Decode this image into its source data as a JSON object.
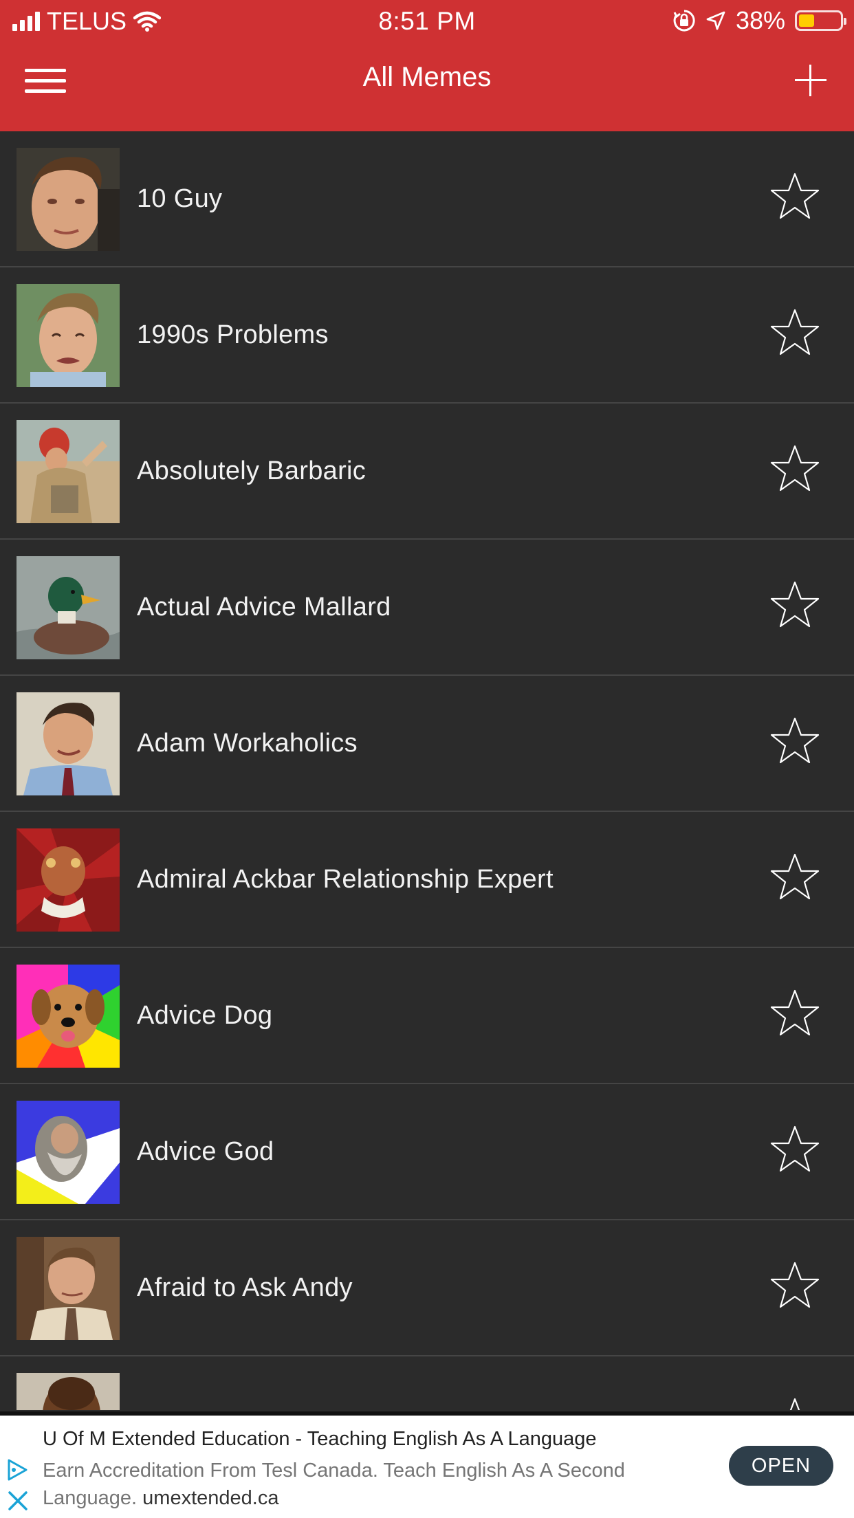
{
  "status_bar": {
    "carrier": "TELUS",
    "time": "8:51 PM",
    "battery_percent": "38%",
    "battery_level": 0.38,
    "icons": [
      "signal-bars-icon",
      "wifi-icon",
      "orientation-lock-icon",
      "location-arrow-icon",
      "battery-icon"
    ]
  },
  "nav": {
    "title": "All Memes",
    "menu_icon": "hamburger-menu-icon",
    "add_icon": "plus-icon"
  },
  "memes": [
    {
      "name": "10 Guy",
      "favorited": false
    },
    {
      "name": "1990s Problems",
      "favorited": false
    },
    {
      "name": "Absolutely Barbaric",
      "favorited": false
    },
    {
      "name": "Actual Advice Mallard",
      "favorited": false
    },
    {
      "name": "Adam Workaholics",
      "favorited": false
    },
    {
      "name": "Admiral Ackbar Relationship Expert",
      "favorited": false
    },
    {
      "name": "Advice Dog",
      "favorited": false
    },
    {
      "name": "Advice God",
      "favorited": false
    },
    {
      "name": "Afraid to Ask Andy",
      "favorited": false
    },
    {
      "name": "",
      "favorited": false
    }
  ],
  "ad": {
    "title": "U Of M Extended Education - Teaching English As A Language",
    "description": "Earn Accreditation From Tesl Canada. Teach English As A Second Language.",
    "domain": "umextended.ca",
    "cta": "OPEN"
  },
  "colors": {
    "header": "#cf3133",
    "background": "#2b2b2b",
    "divider": "#454545",
    "ad_button": "#2e3e4a",
    "battery": "#ffcc00"
  }
}
